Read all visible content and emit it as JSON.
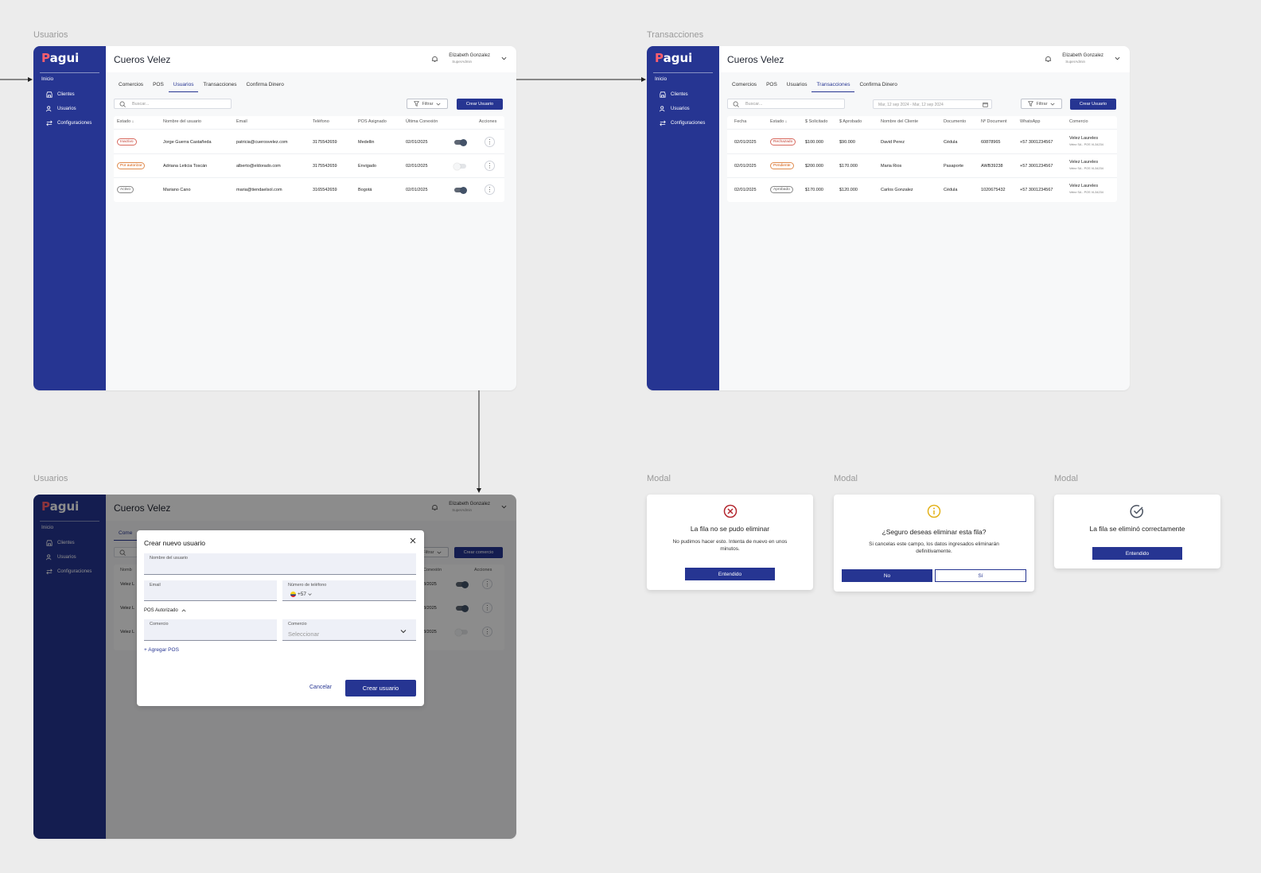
{
  "frames": {
    "users": "Usuarios",
    "transactions": "Transacciones",
    "users2": "Usuarios",
    "modal1": "Modal",
    "modal2": "Modal",
    "modal3": "Modal"
  },
  "app": {
    "logo": "Pagui",
    "logo_first": "P",
    "logo_rest": "agui",
    "inicio": "Inicio",
    "nav": [
      "Clientes",
      "Usuarios",
      "Configuraciones"
    ],
    "brand": "Cueros Velez",
    "user_name": "Elizabeth Gonzalez",
    "user_role": "SuperAdmin",
    "tabs": [
      "Comercios",
      "POS",
      "Usuarios",
      "Transacciones",
      "Confirma Dinero"
    ],
    "search_placeholder": "Buscar...",
    "filter": "Filtrar",
    "filter_alt": "Filtrar",
    "create_user": "Crear Usuario",
    "create_comercio": "Crear comercio"
  },
  "users_table": {
    "headers": [
      "Estado",
      "Nombre del usuario",
      "Email",
      "Teléfono",
      "POS Asignado",
      "Última Conexión",
      "Acciones"
    ],
    "rows": [
      {
        "estado": "Inactivo",
        "nombre": "Jorge Guerra Castañeda",
        "email": "patricia@cuerosvelez.com",
        "telefono": "3175542659",
        "pos": "Medellin",
        "conexion": "02/01/2025",
        "active": true
      },
      {
        "estado": "Por autorizar",
        "nombre": "Adriana Leticia Toscán",
        "email": "alberto@eldorado.com",
        "telefono": "3175542659",
        "pos": "Envigado",
        "conexion": "02/01/2025",
        "active": false
      },
      {
        "estado": "Activo",
        "nombre": "Mariano Cano",
        "email": "maria@tiendaelsol.com",
        "telefono": "3165542659",
        "pos": "Bogotá",
        "conexion": "02/01/2025",
        "active": true
      }
    ]
  },
  "tx_table": {
    "date_range": "Mar, 12 sep 2024 - Mar, 12 sep 2024",
    "headers": [
      "Fecha",
      "Estado",
      "$ Solicitado",
      "$ Aprobado",
      "Nombre del Cliente",
      "Documento",
      "Nº Document",
      "WhatsApp",
      "Comercio"
    ],
    "rows": [
      {
        "fecha": "02/01/2025",
        "estado": "Rechazado",
        "solicitado": "$100.000",
        "aprobado": "$90.000",
        "cliente": "David Perez",
        "documento": "Cédula",
        "numero": "60878965",
        "whatsapp": "+57 3001234567",
        "comercio": "Velez Laureles",
        "sub": "Velez SA - POS VL34234"
      },
      {
        "fecha": "02/01/2025",
        "estado": "Pendiente",
        "solicitado": "$200.000",
        "aprobado": "$170.000",
        "cliente": "Maria Rios",
        "documento": "Pasaporte",
        "numero": "AWB39238",
        "whatsapp": "+57 3001234567",
        "comercio": "Velez Laureles",
        "sub": "Velez SA - POS VL34234"
      },
      {
        "fecha": "02/01/2025",
        "estado": "Aprobado",
        "solicitado": "$170.000",
        "aprobado": "$120.000",
        "cliente": "Carlos Gonzalez",
        "documento": "Cédula",
        "numero": "1020675432",
        "whatsapp": "+57 3001234567",
        "comercio": "Velez Laureles",
        "sub": "Velez SA - POS VL34234"
      }
    ]
  },
  "bg_rows": {
    "names": [
      "Velez L",
      "Velez L",
      "Velez L"
    ],
    "dates": [
      "3/2025",
      "3/2025",
      "3/2025"
    ],
    "header_nombre": "Nomb",
    "header_conexion": "Conexión",
    "header_acciones": "Acciones",
    "tab_partial": "Come"
  },
  "create_modal": {
    "title": "Crear nuevo usuario",
    "name_label": "Nombre del usuario",
    "email_label": "Email",
    "phone_label": "Número de teléfono",
    "phone_code": "+57",
    "pos_section": "POS Autorizado",
    "comercio_label": "Comercio",
    "comercio_select_label": "Comercio",
    "select_placeholder": "Seleccionar",
    "add_pos": "+ Agregar POS",
    "cancel": "Cancelar",
    "submit": "Crear usuario"
  },
  "modal_error": {
    "title": "La fila no se pudo eliminar",
    "desc": "No pudimos hacer esto. Intenta de nuevo en unos minutos.",
    "button": "Entendido"
  },
  "modal_confirm": {
    "title": "¿Seguro deseas eliminar esta fila?",
    "desc": "Si cancelas este campo, los datos ingresados eliminarán definitivamente.",
    "no": "No",
    "yes": "Sí"
  },
  "modal_success": {
    "title": "La fila se eliminó correctamente",
    "button": "Entendido"
  },
  "colors": {
    "primary": "#263592",
    "error": "#b3262e",
    "warning": "#e3b21a",
    "success": "#4a5260"
  }
}
